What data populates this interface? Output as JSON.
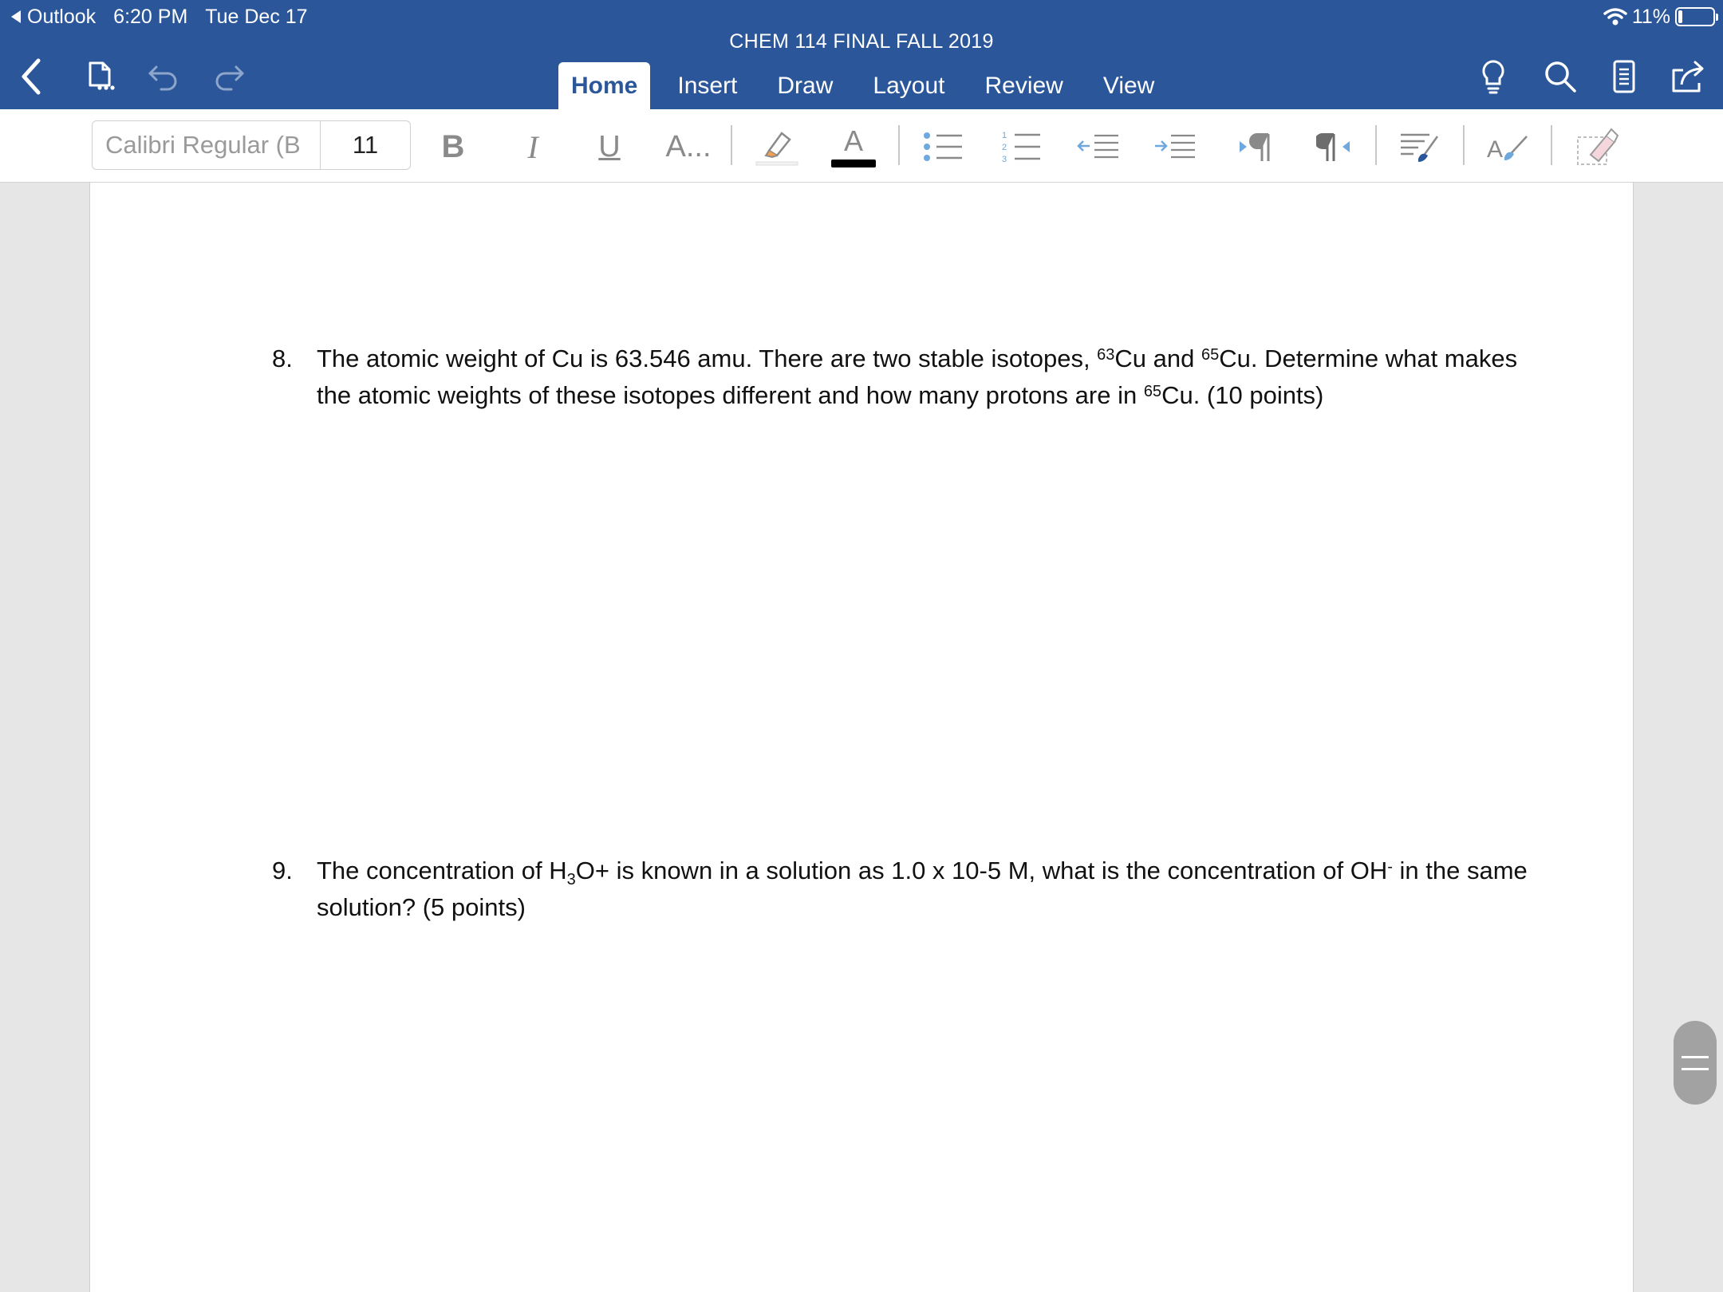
{
  "status_bar": {
    "back_app": "Outlook",
    "time": "6:20 PM",
    "date": "Tue Dec 17",
    "battery": "11%"
  },
  "document": {
    "title": "CHEM 114 FINAL FALL 2019"
  },
  "header_icons": [
    "back-chevron-icon",
    "file-icon",
    "undo-icon",
    "redo-icon",
    "lightbulb-icon",
    "search-icon",
    "mobile-view-icon",
    "share-icon"
  ],
  "tabs": [
    {
      "label": "Home",
      "active": true
    },
    {
      "label": "Insert",
      "active": false
    },
    {
      "label": "Draw",
      "active": false
    },
    {
      "label": "Layout",
      "active": false
    },
    {
      "label": "Review",
      "active": false
    },
    {
      "label": "View",
      "active": false
    }
  ],
  "ribbon": {
    "font_name": "Calibri Regular (B",
    "font_size": "11",
    "bold_label": "B",
    "italic_label": "I",
    "underline_label": "U",
    "font_options_label": "A...",
    "font_color_label": "A",
    "numbered_list_digits": [
      "1",
      "2",
      "3"
    ],
    "font_color_value": "#000000"
  },
  "questions": [
    {
      "number": "8.",
      "parts": {
        "a": "The atomic weight of Cu is 63.546 amu.  There are two stable isotopes, ",
        "sup1": "63",
        "b": "Cu and ",
        "sup2": "65",
        "c": "Cu. Determine what makes the atomic weights of these isotopes different and how many protons are in ",
        "sup3": "65",
        "d": "Cu. (10 points)"
      }
    },
    {
      "number": "9.",
      "parts": {
        "a": "The concentration of H",
        "sub1": "3",
        "b": "O+ is known in a solution as 1.0 x 10-5 M, what is the concentration of OH",
        "sup1": "-",
        "c": " in the same solution?  (5 points)"
      }
    }
  ],
  "colors": {
    "header_blue": "#2b579a",
    "ribbon_icon_gray": "#8a8a8a",
    "list_icon_blue": "#6fa8dc"
  }
}
